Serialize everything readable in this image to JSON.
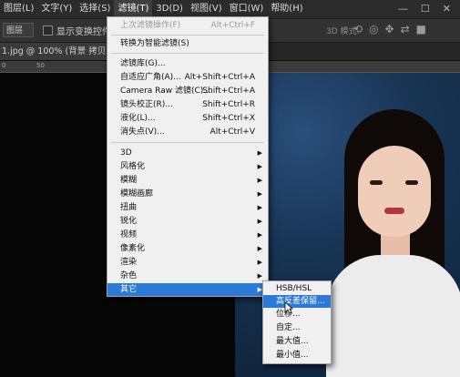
{
  "menubar": {
    "items": [
      "图层(L)",
      "文字(Y)",
      "选择(S)",
      "滤镜(T)",
      "3D(D)",
      "视图(V)",
      "窗口(W)",
      "帮助(H)"
    ],
    "active_index": 3,
    "window_controls": [
      "—",
      "☐",
      "✕"
    ]
  },
  "options_bar": {
    "select_value": "图层",
    "checkbox_label": "显示变换控件",
    "mode_label": "3D 模式:"
  },
  "document_tab": {
    "label": "1.jpg @ 100% (背景 拷贝, RGB...)"
  },
  "ruler": {
    "ticks": [
      "0",
      "50"
    ]
  },
  "filter_menu": {
    "items": [
      {
        "label": "上次滤镜操作(F)",
        "shortcut": "Alt+Ctrl+F",
        "disabled": true
      },
      {
        "label": "转换为智能滤镜(S)",
        "shortcut": ""
      },
      {
        "label": "滤镜库(G)...",
        "shortcut": ""
      },
      {
        "label": "自适应广角(A)...",
        "shortcut": "Alt+Shift+Ctrl+A"
      },
      {
        "label": "Camera Raw 滤镜(C)...",
        "shortcut": "Shift+Ctrl+A"
      },
      {
        "label": "镜头校正(R)...",
        "shortcut": "Shift+Ctrl+R"
      },
      {
        "label": "液化(L)...",
        "shortcut": "Shift+Ctrl+X"
      },
      {
        "label": "消失点(V)...",
        "shortcut": "Alt+Ctrl+V"
      },
      {
        "label": "3D",
        "submenu": true
      },
      {
        "label": "风格化",
        "submenu": true
      },
      {
        "label": "模糊",
        "submenu": true
      },
      {
        "label": "模糊画廊",
        "submenu": true
      },
      {
        "label": "扭曲",
        "submenu": true
      },
      {
        "label": "锐化",
        "submenu": true
      },
      {
        "label": "视频",
        "submenu": true
      },
      {
        "label": "像素化",
        "submenu": true
      },
      {
        "label": "渲染",
        "submenu": true
      },
      {
        "label": "杂色",
        "submenu": true
      },
      {
        "label": "其它",
        "submenu": true,
        "highlighted": true
      }
    ]
  },
  "other_submenu": {
    "items": [
      {
        "label": "HSB/HSL"
      },
      {
        "label": "高反差保留...",
        "highlighted": true
      },
      {
        "label": "位移..."
      },
      {
        "label": "自定..."
      },
      {
        "label": "最大值..."
      },
      {
        "label": "最小值..."
      }
    ]
  },
  "colors": {
    "highlight": "#2b7ad7",
    "menu_bg": "#f0f0f0",
    "app_bg": "#1f1f1f"
  }
}
